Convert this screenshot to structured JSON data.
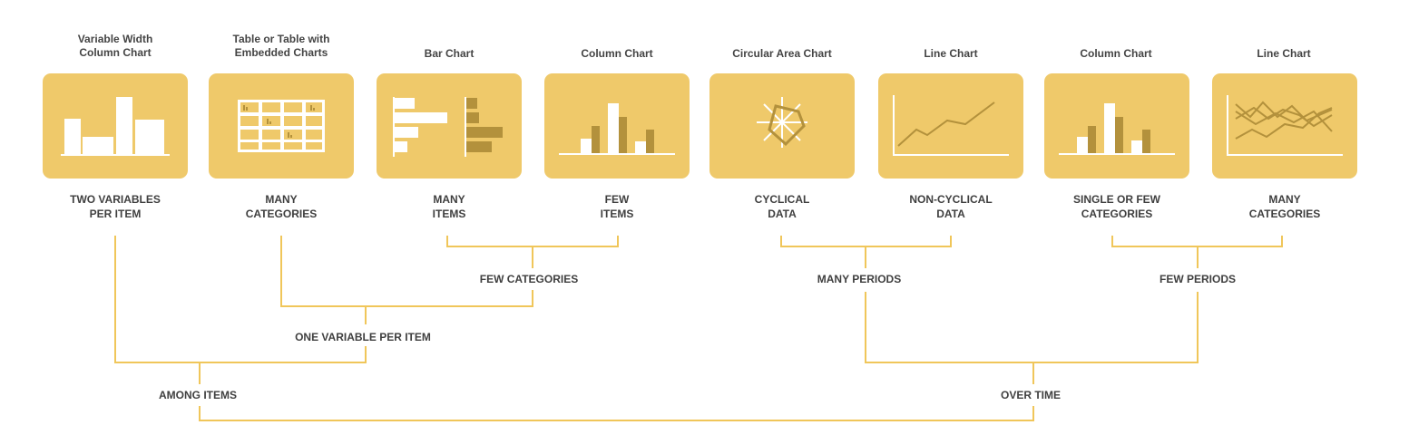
{
  "colors": {
    "card": "#efc96a",
    "line": "#f0c65a",
    "dark": "#b3913c",
    "white": "#ffffff"
  },
  "charts": [
    {
      "title": "Variable Width\nColumn Chart",
      "icon": "variable-width-column-icon",
      "label": "TWO VARIABLES\nPER ITEM"
    },
    {
      "title": "Table or Table with\nEmbedded Charts",
      "icon": "table-embedded-charts-icon",
      "label": "MANY\nCATEGORIES"
    },
    {
      "title": "Bar Chart",
      "icon": "bar-chart-icon",
      "label": "MANY\nITEMS"
    },
    {
      "title": "Column Chart",
      "icon": "column-chart-icon",
      "label": "FEW\nITEMS"
    },
    {
      "title": "Circular Area Chart",
      "icon": "circular-area-chart-icon",
      "label": "CYCLICAL\nDATA"
    },
    {
      "title": "Line Chart",
      "icon": "line-chart-icon",
      "label": "NON-CYCLICAL\nDATA"
    },
    {
      "title": "Column Chart",
      "icon": "column-chart-icon",
      "label": "SINGLE OR FEW\nCATEGORIES"
    },
    {
      "title": "Line Chart",
      "icon": "multi-line-chart-icon",
      "label": "MANY\nCATEGORIES"
    }
  ],
  "groups": {
    "few_categories": "FEW CATEGORIES",
    "many_periods": "MANY PERIODS",
    "few_periods": "FEW PERIODS",
    "one_variable_per_item": "ONE VARIABLE PER ITEM",
    "among_items": "AMONG ITEMS",
    "over_time": "OVER TIME"
  }
}
